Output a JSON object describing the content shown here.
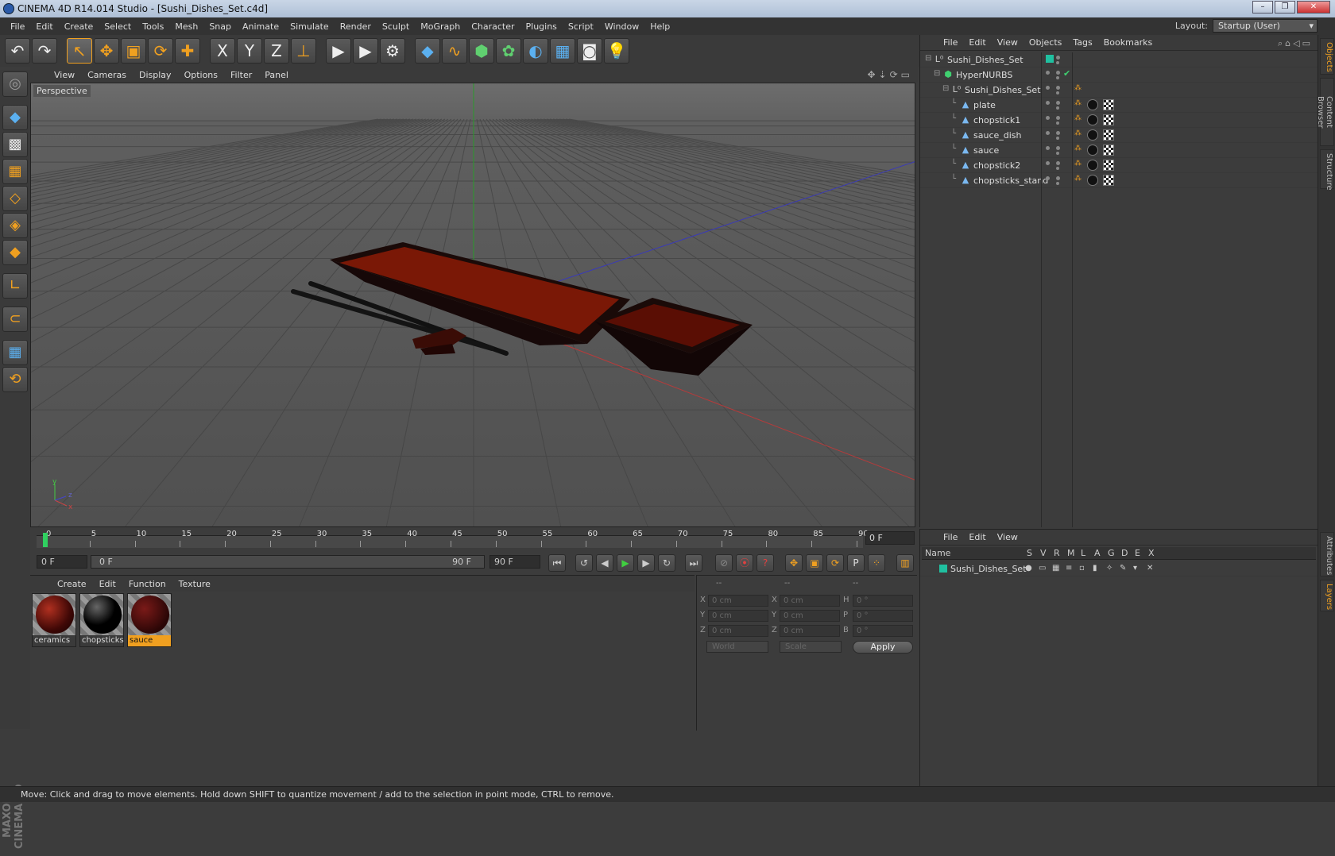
{
  "window": {
    "title": "CINEMA 4D R14.014 Studio - [Sushi_Dishes_Set.c4d]"
  },
  "menu": [
    "File",
    "Edit",
    "Create",
    "Select",
    "Tools",
    "Mesh",
    "Snap",
    "Animate",
    "Simulate",
    "Render",
    "Sculpt",
    "MoGraph",
    "Character",
    "Plugins",
    "Script",
    "Window",
    "Help"
  ],
  "layout": {
    "label": "Layout:",
    "value": "Startup (User)"
  },
  "toolbar_icons": [
    "undo-icon",
    "redo-icon",
    "live-select-icon",
    "move-icon",
    "scale-icon",
    "rotate-icon",
    "add-icon",
    "x-axis-icon",
    "y-axis-icon",
    "z-axis-icon",
    "coordinate-system-icon",
    "render-view-icon",
    "render-picture-viewer-icon",
    "render-settings-icon",
    "cube-icon",
    "spline-icon",
    "nurbs-icon",
    "array-icon",
    "deformer-icon",
    "floor-icon",
    "camera-icon",
    "light-icon"
  ],
  "toolbar_glyphs": {
    "undo": "↶",
    "redo": "↷",
    "select": "↖",
    "move": "✥",
    "scale": "▣",
    "rotate": "⟳",
    "add": "✚",
    "x": "X",
    "y": "Y",
    "z": "Z",
    "coord": "⊥",
    "render1": "▶",
    "render2": "▶",
    "render3": "⚙",
    "cube": "◆",
    "spline": "∿",
    "nurbs": "⬢",
    "array": "✿",
    "deformer": "◐",
    "floor": "▦",
    "camera": "◙",
    "light": "💡"
  },
  "viewport": {
    "menu": [
      "View",
      "Cameras",
      "Display",
      "Options",
      "Filter",
      "Panel"
    ],
    "label": "Perspective",
    "axis": {
      "y": "y",
      "x": "x",
      "z": "z"
    }
  },
  "timeline": {
    "ticks": [
      "0",
      "5",
      "10",
      "15",
      "20",
      "25",
      "30",
      "35",
      "40",
      "45",
      "50",
      "55",
      "60",
      "65",
      "70",
      "75",
      "80",
      "85",
      "90"
    ],
    "current_frame": "0 F"
  },
  "playback": {
    "start": "0 F",
    "scrub_start": "0 F",
    "scrub_end": "90 F",
    "end": "90 F"
  },
  "materials": {
    "menu": [
      "Create",
      "Edit",
      "Function",
      "Texture"
    ],
    "items": [
      {
        "name": "ceramics",
        "selected": false
      },
      {
        "name": "chopsticks",
        "selected": false
      },
      {
        "name": "sauce",
        "selected": true
      }
    ]
  },
  "coords": {
    "headers": [
      "--",
      "--",
      "--"
    ],
    "rows": [
      {
        "a": "X",
        "av": "0 cm",
        "b": "X",
        "bv": "0 cm",
        "c": "H",
        "cv": "0 °"
      },
      {
        "a": "Y",
        "av": "0 cm",
        "b": "Y",
        "bv": "0 cm",
        "c": "P",
        "cv": "0 °"
      },
      {
        "a": "Z",
        "av": "0 cm",
        "b": "Z",
        "bv": "0 cm",
        "c": "B",
        "cv": "0 °"
      }
    ],
    "space": "World",
    "mode": "Scale",
    "apply": "Apply"
  },
  "objects": {
    "menu": [
      "File",
      "Edit",
      "View",
      "Objects",
      "Tags",
      "Bookmarks"
    ],
    "items": [
      {
        "name": "Sushi_Dishes_Set",
        "level": 0,
        "icon": "null-icon"
      },
      {
        "name": "HyperNURBS",
        "level": 1,
        "icon": "hypernurbs-icon"
      },
      {
        "name": "Sushi_Dishes_Set",
        "level": 2,
        "icon": "null-icon"
      },
      {
        "name": "plate",
        "level": 3,
        "icon": "polygon-object-icon"
      },
      {
        "name": "chopstick1",
        "level": 3,
        "icon": "polygon-object-icon"
      },
      {
        "name": "sauce_dish",
        "level": 3,
        "icon": "polygon-object-icon"
      },
      {
        "name": "sauce",
        "level": 3,
        "icon": "polygon-object-icon"
      },
      {
        "name": "chopstick2",
        "level": 3,
        "icon": "polygon-object-icon"
      },
      {
        "name": "chopsticks_stand",
        "level": 3,
        "icon": "polygon-object-icon"
      }
    ]
  },
  "layers": {
    "menu": [
      "File",
      "Edit",
      "View"
    ],
    "columns": [
      "Name",
      "S",
      "V",
      "R",
      "M",
      "L",
      "A",
      "G",
      "D",
      "E",
      "X"
    ],
    "rows": [
      {
        "name": "Sushi_Dishes_Set",
        "color": "#20c0a0"
      }
    ]
  },
  "side_tabs": [
    "Objects",
    "Content Browser",
    "Structure",
    "Attributes",
    "Layers"
  ],
  "brand": "MAXON CINEMA 4D",
  "status": "Move: Click and drag to move elements. Hold down SHIFT to quantize movement / add to the selection in point mode, CTRL to remove.",
  "colors": {
    "accent": "#f0a020",
    "layer": "#20c0a0",
    "plate_inner": "#8a1a08"
  }
}
